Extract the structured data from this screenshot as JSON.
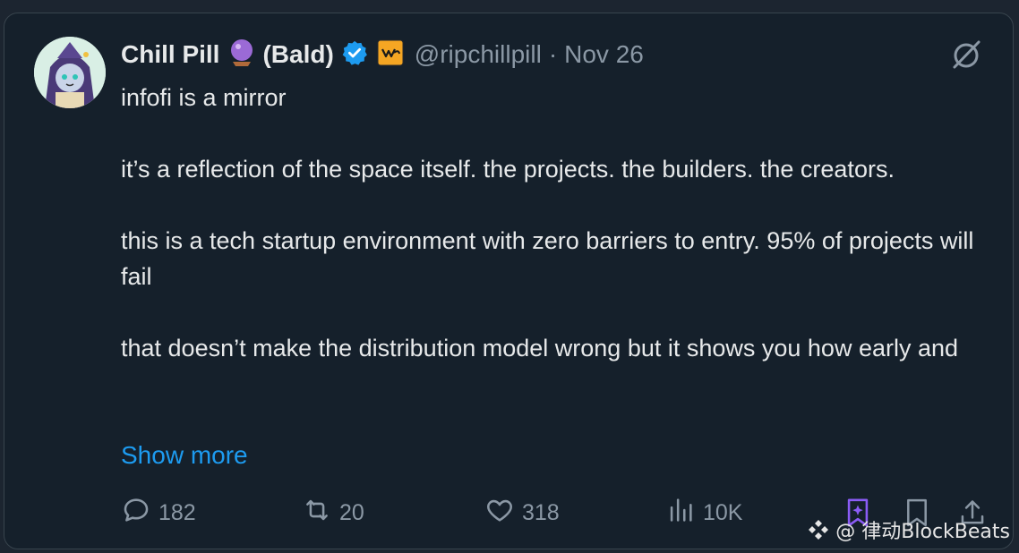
{
  "tweet": {
    "display_name": "Chill Pill",
    "name_suffix": "(Bald)",
    "handle": "@ripchillpill",
    "separator": "·",
    "date": "Nov 26",
    "paragraphs": [
      "infofi is a mirror",
      "it’s a reflection of the space itself. the projects. the builders. the creators.",
      "this is a tech startup environment with zero barriers to entry. 95% of projects will fail",
      "that doesn’t make the distribution model wrong but it shows you how early and"
    ],
    "show_more": "Show more"
  },
  "actions": {
    "replies": "182",
    "reposts": "20",
    "likes": "318",
    "views": "10K"
  },
  "watermark": {
    "text": "@ 律动BlockBeats"
  },
  "colors": {
    "background": "#15202b",
    "text": "#e7e9ea",
    "secondary": "#8b98a5",
    "link": "#1d9bf0",
    "grok_purple": "#8b5cf6"
  },
  "icons": [
    "crystal-ball-icon",
    "verified-badge-icon",
    "affiliate-badge-icon",
    "grok-icon",
    "reply-icon",
    "repost-icon",
    "like-icon",
    "views-icon",
    "grok-bookmark-icon",
    "bookmark-icon",
    "share-icon"
  ]
}
